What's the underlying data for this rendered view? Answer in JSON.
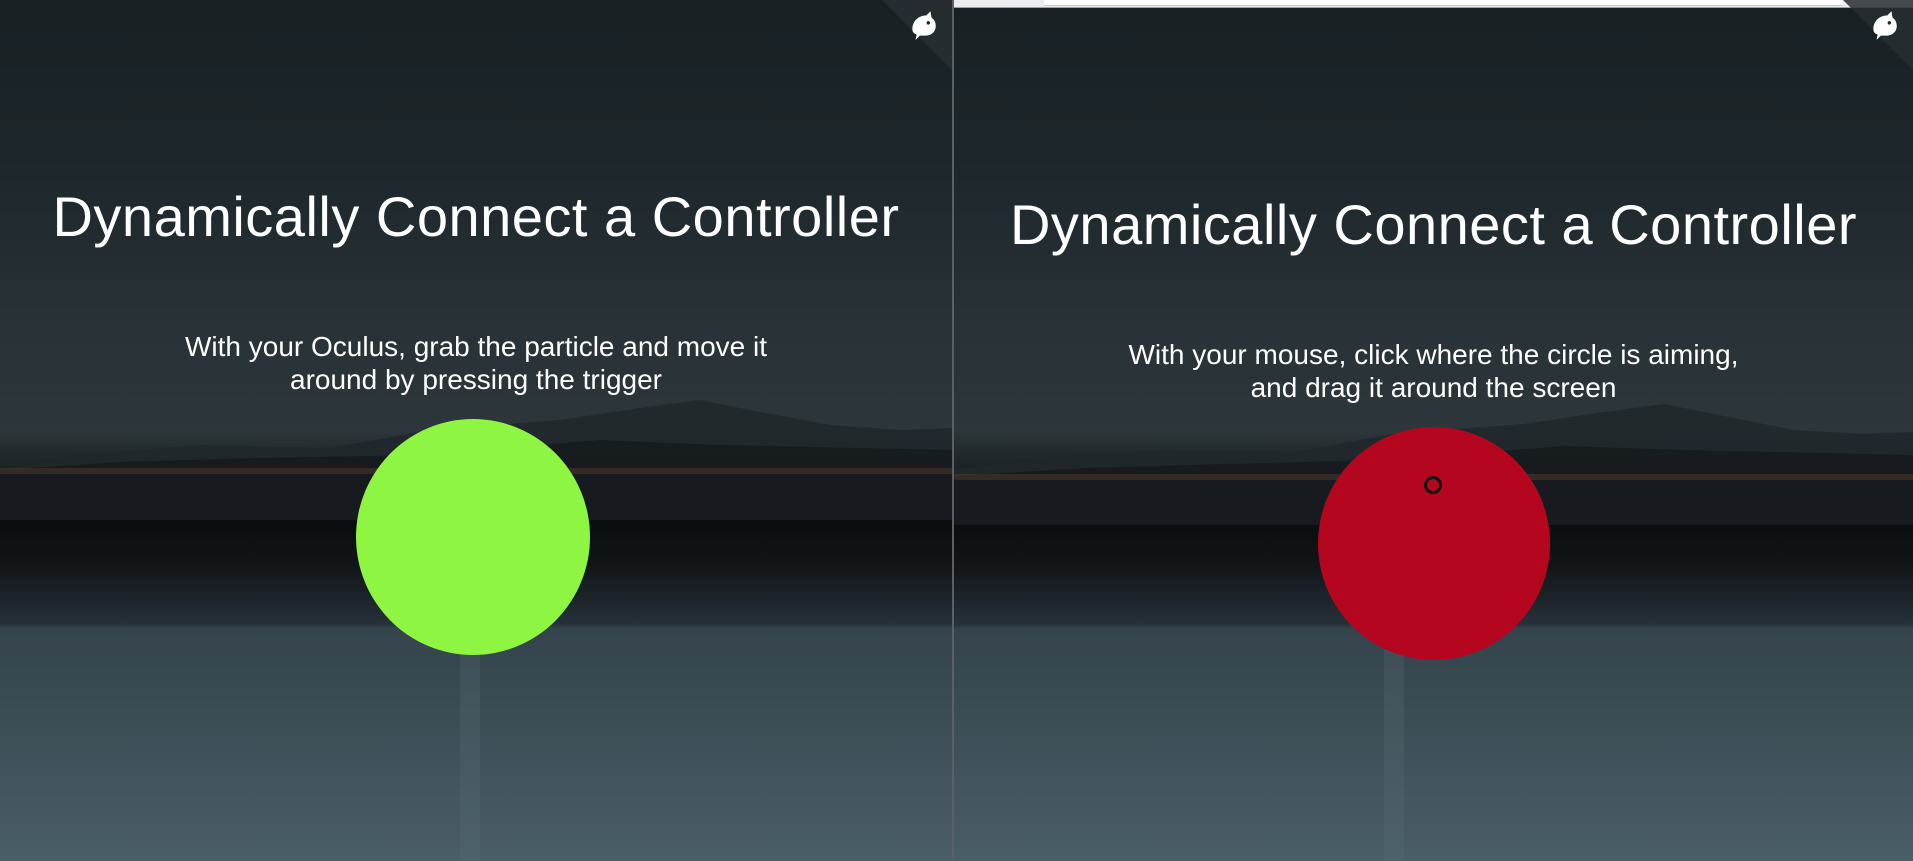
{
  "left_panel": {
    "title": "Dynamically Connect a Controller",
    "instruction_line1": "With your Oculus, grab the particle and move it",
    "instruction_line2": "around by pressing the trigger",
    "particle_color": "#8ef542",
    "corner_icon": "cat-octo-icon"
  },
  "right_panel": {
    "title": "Dynamically Connect a Controller",
    "instruction_line1": "With your mouse, click where the circle is aiming,",
    "instruction_line2": "and drag it around the screen",
    "particle_color": "#b5061f",
    "cursor_icon": "ring-cursor-icon",
    "corner_icon": "cat-octo-icon"
  },
  "colors": {
    "text": "#ffffff",
    "divider": "#5a6166"
  }
}
